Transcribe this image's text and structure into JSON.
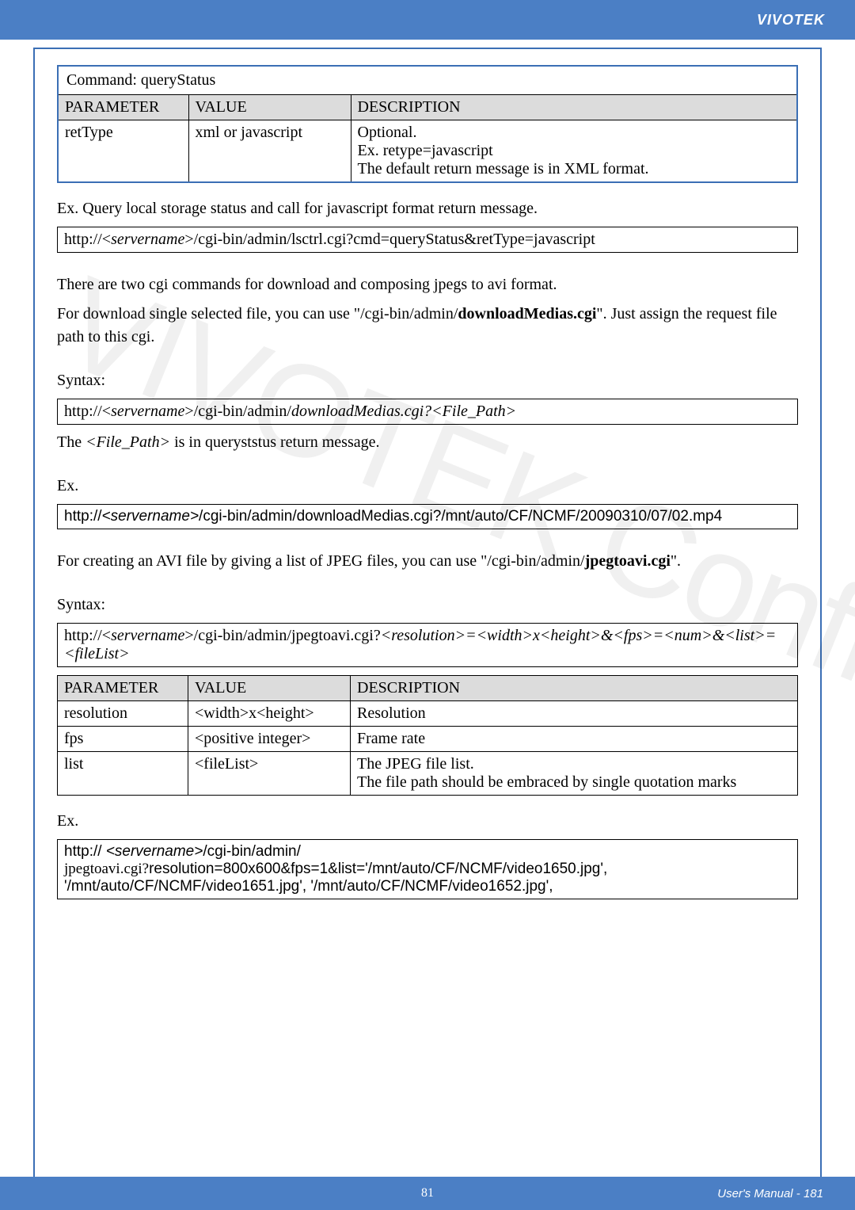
{
  "header": {
    "brand": "VIVOTEK"
  },
  "watermark": "VIVOTEK Confidential",
  "cmdTable": {
    "command": "Command: queryStatus",
    "headers": {
      "p": "PARAMETER",
      "v": "VALUE",
      "d": "DESCRIPTION"
    },
    "row": {
      "param": "retType",
      "value": "xml or javascript",
      "desc1": "Optional.",
      "desc2": "Ex. retype=javascript",
      "desc3": "The default return message is in XML format."
    }
  },
  "para1": "Ex. Query local storage status and call for javascript format return message.",
  "code1_pre": "http://<",
  "code1_serv": "servername",
  "code1_post": ">/cgi-bin/admin/lsctrl.cgi?cmd=queryStatus&retType=javascript",
  "para2": "There are two cgi commands for download and composing jpegs to avi format.",
  "para3a": "For download single selected file, you can use \"/cgi-bin/admin/",
  "para3b": "downloadMedias.cgi",
  "para3c": "\". Just assign the request file path to this cgi.",
  "syntax_label": "Syntax:",
  "code2_pre": "http://<",
  "code2_serv": "servername",
  "code2_mid": ">/cgi-bin/admin/",
  "code2_tail": "downloadMedias.cgi?<File_Path>",
  "para4a": "The ",
  "para4b": "<File_Path>",
  "para4c": " is in queryststus return message.",
  "ex_label": "Ex.",
  "code3_pre": "http://",
  "code3_serv": "<servername>",
  "code3_rest": "/cgi-bin/admin/downloadMedias.cgi?/mnt/auto/CF/NCMF/20090310/07/02.mp4",
  "para5a": "For creating an AVI file by giving a list of JPEG files, you can use \"/cgi-bin/admin/",
  "para5b": "jpegtoavi.cgi",
  "para5c": "\".",
  "code4_pre": "http://<",
  "code4_serv": "servername",
  "code4_mid": ">/cgi-bin/admin/jpegtoavi.cgi?",
  "code4_tail": "<resolution>=<width>x<height>&<fps>=<num>&<list>=<fileList>",
  "paramsTable": {
    "headers": {
      "p": "PARAMETER",
      "v": "VALUE",
      "d": "DESCRIPTION"
    },
    "rows": {
      "r1": {
        "p": "resolution",
        "v": "<width>x<height>",
        "d": "Resolution"
      },
      "r2": {
        "p": "fps",
        "v": "<positive integer>",
        "d": "Frame rate"
      },
      "r3": {
        "p": "list",
        "v": "<fileList>",
        "d1": "The JPEG file list.",
        "d2": "The file path should be embraced by single quotation marks"
      }
    }
  },
  "code5_pre": "http:// ",
  "code5_serv": "<servername>",
  "code5_rest1": "/cgi-bin/admin/",
  "code5_line2a": "jpegtoavi.cgi?",
  "code5_line2b": "resolution=800x600&fps=1&list='/mnt/auto/CF/NCMF/video1650.jpg', '/mnt/auto/CF/NCMF/video1651.jpg', '/mnt/auto/CF/NCMF/video1652.jpg',",
  "footer": {
    "page": "81",
    "manual": "User's Manual - 181"
  }
}
